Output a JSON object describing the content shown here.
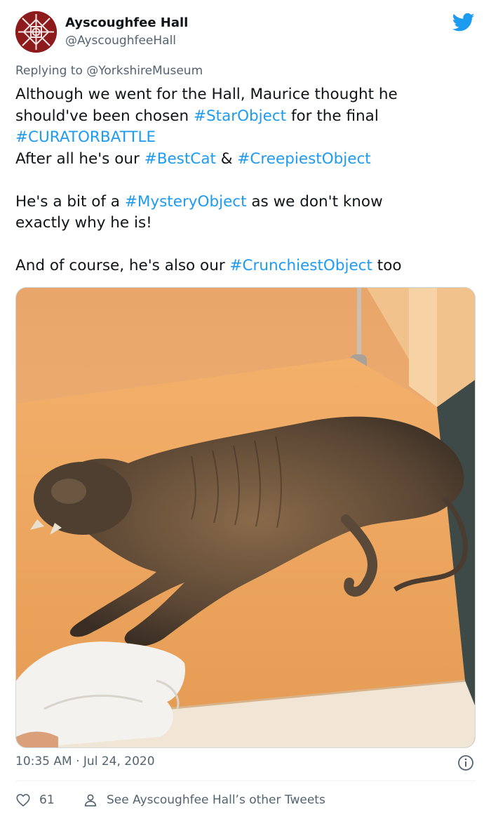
{
  "author": {
    "display_name": "Ayscoughfee Hall",
    "handle": "@AyscoughfeeHall",
    "avatar": "red-knot-emblem"
  },
  "platform_icon": "twitter-bird-icon",
  "reply": {
    "prefix": "Replying to ",
    "mention": "@YorkshireMuseum"
  },
  "tweet": {
    "l1": "Although we went for the Hall, Maurice thought he",
    "l2_a": "should've been chosen ",
    "l2_tag": "#StarObject",
    "l2_b": " for the final",
    "l3_tag": "#CURATORBATTLE",
    "l4_a": "After all he's our ",
    "l4_tag1": "#BestCat",
    "l4_b": " & ",
    "l4_tag2": "#CreepiestObject",
    "l5_a": "He's a bit of a ",
    "l5_tag": "#MysteryObject",
    "l5_b": " as we don't know",
    "l6": "exactly why he is!",
    "l7_a": "And of course, he's also our ",
    "l7_tag": "#CrunchiestObject",
    "l7_b": " too"
  },
  "media": {
    "kind": "photo"
  },
  "meta": {
    "time": "10:35 AM",
    "separator": " · ",
    "date": "Jul 24, 2020"
  },
  "actions": {
    "like_count": "61",
    "other_tweets_label": "See Ayscoughfee Hall’s other Tweets"
  },
  "colors": {
    "link": "#1d9bf0",
    "secondary_text": "#536471",
    "brand": "#1d9bf0",
    "avatar_red": "#8e1b1b"
  }
}
